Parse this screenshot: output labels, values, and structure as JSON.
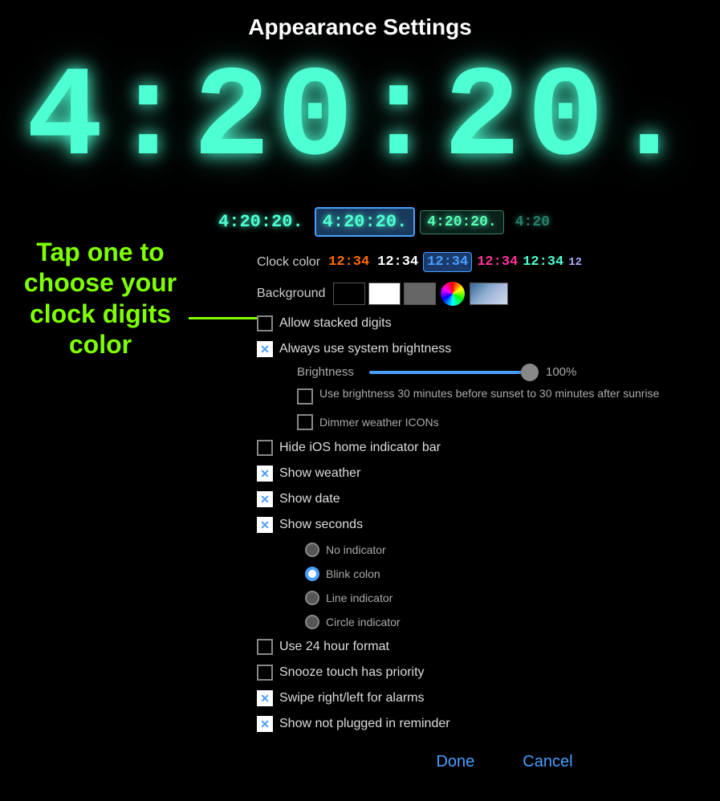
{
  "page": {
    "title": "Appearance Settings",
    "background_color": "#000000"
  },
  "big_clock": {
    "display": "4:20:20.",
    "color": "#4dffd2"
  },
  "tap_hint": {
    "line1": "Tap one to",
    "line2": "choose your",
    "line3": "clock digits",
    "line4": "color"
  },
  "clock_variants": [
    {
      "label": "4:20:20.",
      "style": "normal"
    },
    {
      "label": "4:20:20.",
      "style": "selected"
    },
    {
      "label": "4:20:20.",
      "style": "dim-green"
    },
    {
      "label": "4:20",
      "style": "faded"
    }
  ],
  "clock_color": {
    "label": "Clock color",
    "options": [
      {
        "label": "12:34",
        "color": "#ff6a00",
        "selected": false
      },
      {
        "label": "12:34",
        "color": "#ffffff",
        "selected": false
      },
      {
        "label": "12:34",
        "color": "#4a9eff",
        "selected": true
      },
      {
        "label": "12:34",
        "color": "#ff3399",
        "selected": false
      },
      {
        "label": "12:34",
        "color": "#4dffd2",
        "selected": false
      },
      {
        "label": "12",
        "color": "#aaaaff",
        "selected": false
      }
    ]
  },
  "background": {
    "label": "Background",
    "options": [
      {
        "type": "black",
        "label": "Black"
      },
      {
        "type": "white",
        "label": "White"
      },
      {
        "type": "gray",
        "label": "Gray"
      },
      {
        "type": "colorwheel",
        "label": "Color wheel"
      },
      {
        "type": "photo",
        "label": "Photo"
      }
    ]
  },
  "checkboxes": [
    {
      "id": "allow-stacked",
      "label": "Allow stacked digits",
      "checked": false,
      "indented": false
    },
    {
      "id": "system-brightness",
      "label": "Always use system brightness",
      "checked": true,
      "indented": false
    }
  ],
  "brightness": {
    "label": "Brightness",
    "value": 100,
    "display": "100%"
  },
  "more_checkboxes": [
    {
      "id": "sunset-brightness",
      "label": "Use brightness 30 minutes before sunset to 30 minutes after sunrise",
      "checked": false,
      "indented": true,
      "small": true
    },
    {
      "id": "dimmer-weather",
      "label": "Dimmer weather ICONs",
      "checked": false,
      "indented": true
    },
    {
      "id": "hide-home-bar",
      "label": "Hide iOS home indicator bar",
      "checked": false,
      "indented": false
    },
    {
      "id": "show-weather",
      "label": "Show weather",
      "checked": true,
      "indented": false
    },
    {
      "id": "show-date",
      "label": "Show date",
      "checked": true,
      "indented": false
    },
    {
      "id": "show-seconds",
      "label": "Show seconds",
      "checked": true,
      "indented": false
    }
  ],
  "seconds_options": [
    {
      "id": "no-indicator",
      "label": "No indicator",
      "selected": false
    },
    {
      "id": "blink-colon",
      "label": "Blink colon",
      "selected": true
    },
    {
      "id": "line-indicator",
      "label": "Line indicator",
      "selected": false
    },
    {
      "id": "circle-indicator",
      "label": "Circle indicator",
      "selected": false
    }
  ],
  "bottom_checkboxes": [
    {
      "id": "24hour",
      "label": "Use 24 hour format",
      "checked": false
    },
    {
      "id": "snooze-priority",
      "label": "Snooze touch has priority",
      "checked": false
    },
    {
      "id": "swipe-alarms",
      "label": "Swipe right/left for alarms",
      "checked": true
    },
    {
      "id": "plugged-reminder",
      "label": "Show not plugged in reminder",
      "checked": true
    }
  ],
  "buttons": {
    "done": "Done",
    "cancel": "Cancel"
  }
}
